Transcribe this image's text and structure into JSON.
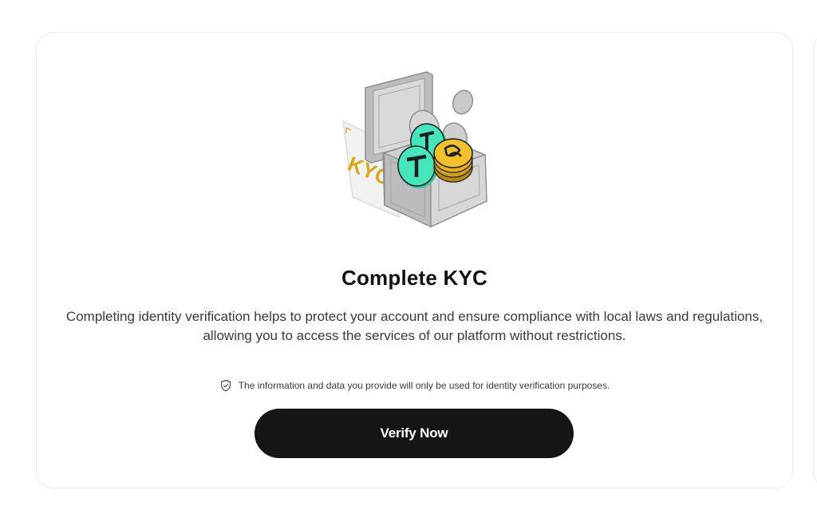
{
  "card": {
    "title": "Complete KYC",
    "description": "Completing identity verification helps to protect your account and ensure compliance with local laws and regulations, allowing you to access the services of our platform without restrictions.",
    "note": {
      "icon": "shield-check-icon",
      "text": "The information and data you provide will only be used for identity verification purposes."
    },
    "button_label": "Verify Now",
    "illustration": {
      "name": "kyc-safe-illustration",
      "card_text": "KYC"
    }
  },
  "colors": {
    "button_bg": "#151515",
    "button_text": "#ffffff",
    "title": "#121212",
    "body_text": "#3a3a3a",
    "card_border": "#ebebeb",
    "coin_teal": "#3fe0b5",
    "coin_gold": "#e8b21e"
  }
}
